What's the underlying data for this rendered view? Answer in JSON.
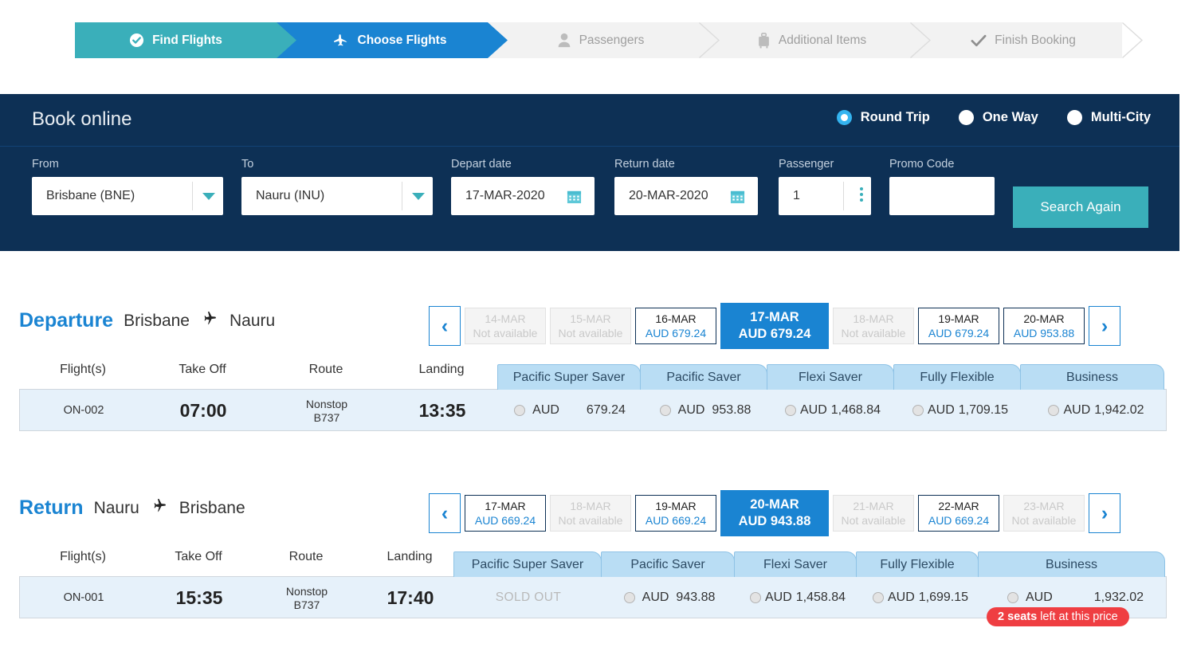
{
  "steps": [
    {
      "label": "Find Flights",
      "icon": "check-circle-icon",
      "state": "done"
    },
    {
      "label": "Choose Flights",
      "icon": "plane-icon",
      "state": "active"
    },
    {
      "label": "Passengers",
      "icon": "person-icon",
      "state": "upcoming"
    },
    {
      "label": "Additional Items",
      "icon": "suitcase-icon",
      "state": "upcoming"
    },
    {
      "label": "Finish Booking",
      "icon": "check-icon",
      "state": "upcoming"
    }
  ],
  "booking": {
    "title": "Book online",
    "trip_types": [
      {
        "label": "Round Trip",
        "selected": true
      },
      {
        "label": "One Way",
        "selected": false
      },
      {
        "label": "Multi-City",
        "selected": false
      }
    ],
    "fields": {
      "from": {
        "label": "From",
        "value": "Brisbane (BNE)"
      },
      "to": {
        "label": "To",
        "value": "Nauru (INU)"
      },
      "depart_date": {
        "label": "Depart date",
        "value": "17-MAR-2020"
      },
      "return_date": {
        "label": "Return date",
        "value": "20-MAR-2020"
      },
      "passenger": {
        "label": "Passenger",
        "value": "1"
      },
      "promo_code": {
        "label": "Promo Code",
        "value": ""
      }
    },
    "search_button": "Search Again",
    "accent_color": "#3aafba",
    "panel_color": "#0d3055"
  },
  "departure": {
    "heading": "Departure",
    "origin": "Brisbane",
    "destination": "Nauru",
    "prev_label": "‹",
    "next_label": "›",
    "dates": [
      {
        "day": "14-MAR",
        "price": "Not available",
        "available": false,
        "selected": false
      },
      {
        "day": "15-MAR",
        "price": "Not available",
        "available": false,
        "selected": false
      },
      {
        "day": "16-MAR",
        "price": "AUD 679.24",
        "available": true,
        "selected": false
      },
      {
        "day": "17-MAR",
        "price": "AUD 679.24",
        "available": true,
        "selected": true
      },
      {
        "day": "18-MAR",
        "price": "Not available",
        "available": false,
        "selected": false
      },
      {
        "day": "19-MAR",
        "price": "AUD 679.24",
        "available": true,
        "selected": false
      },
      {
        "day": "20-MAR",
        "price": "AUD 953.88",
        "available": true,
        "selected": false
      }
    ],
    "columns": [
      "Flight(s)",
      "Take Off",
      "Route",
      "Landing"
    ],
    "fare_classes": [
      "Pacific Super Saver",
      "Pacific Saver",
      "Flexi Saver",
      "Fully Flexible",
      "Business"
    ],
    "flight": {
      "number": "ON-002",
      "take_off": "07:00",
      "route_stops": "Nonstop",
      "route_aircraft": "B737",
      "landing": "13:35",
      "fares": [
        {
          "currency": "AUD",
          "amount": "679.24",
          "sold_out": false,
          "wide_gap": true
        },
        {
          "currency": "AUD",
          "amount": "953.88",
          "sold_out": false,
          "wide_gap": false
        },
        {
          "currency": "AUD",
          "amount": "1,468.84",
          "sold_out": false,
          "wide_gap": false
        },
        {
          "currency": "AUD",
          "amount": "1,709.15",
          "sold_out": false,
          "wide_gap": false
        },
        {
          "currency": "AUD",
          "amount": "1,942.02",
          "sold_out": false,
          "wide_gap": false
        }
      ]
    }
  },
  "return": {
    "heading": "Return",
    "origin": "Nauru",
    "destination": "Brisbane",
    "prev_label": "‹",
    "next_label": "›",
    "dates": [
      {
        "day": "17-MAR",
        "price": "AUD 669.24",
        "available": true,
        "selected": false
      },
      {
        "day": "18-MAR",
        "price": "Not available",
        "available": false,
        "selected": false
      },
      {
        "day": "19-MAR",
        "price": "AUD 669.24",
        "available": true,
        "selected": false
      },
      {
        "day": "20-MAR",
        "price": "AUD 943.88",
        "available": true,
        "selected": true
      },
      {
        "day": "21-MAR",
        "price": "Not available",
        "available": false,
        "selected": false
      },
      {
        "day": "22-MAR",
        "price": "AUD 669.24",
        "available": true,
        "selected": false
      },
      {
        "day": "23-MAR",
        "price": "Not available",
        "available": false,
        "selected": false
      }
    ],
    "columns": [
      "Flight(s)",
      "Take Off",
      "Route",
      "Landing"
    ],
    "fare_classes": [
      "Pacific Super Saver",
      "Pacific Saver",
      "Flexi Saver",
      "Fully Flexible",
      "Business"
    ],
    "flight": {
      "number": "ON-001",
      "take_off": "15:35",
      "route_stops": "Nonstop",
      "route_aircraft": "B737",
      "landing": "17:40",
      "sold_out_label": "SOLD OUT",
      "fares": [
        {
          "sold_out": true
        },
        {
          "currency": "AUD",
          "amount": "943.88",
          "sold_out": false,
          "wide_gap": false
        },
        {
          "currency": "AUD",
          "amount": "1,458.84",
          "sold_out": false,
          "wide_gap": false
        },
        {
          "currency": "AUD",
          "amount": "1,699.15",
          "sold_out": false,
          "wide_gap": false
        },
        {
          "currency": "AUD",
          "amount": "1,932.02",
          "sold_out": false,
          "wide_gap": true
        }
      ]
    },
    "seats_badge": {
      "count_text": "2 seats",
      "rest_text": "left at this price",
      "color": "#ef3e42"
    }
  }
}
